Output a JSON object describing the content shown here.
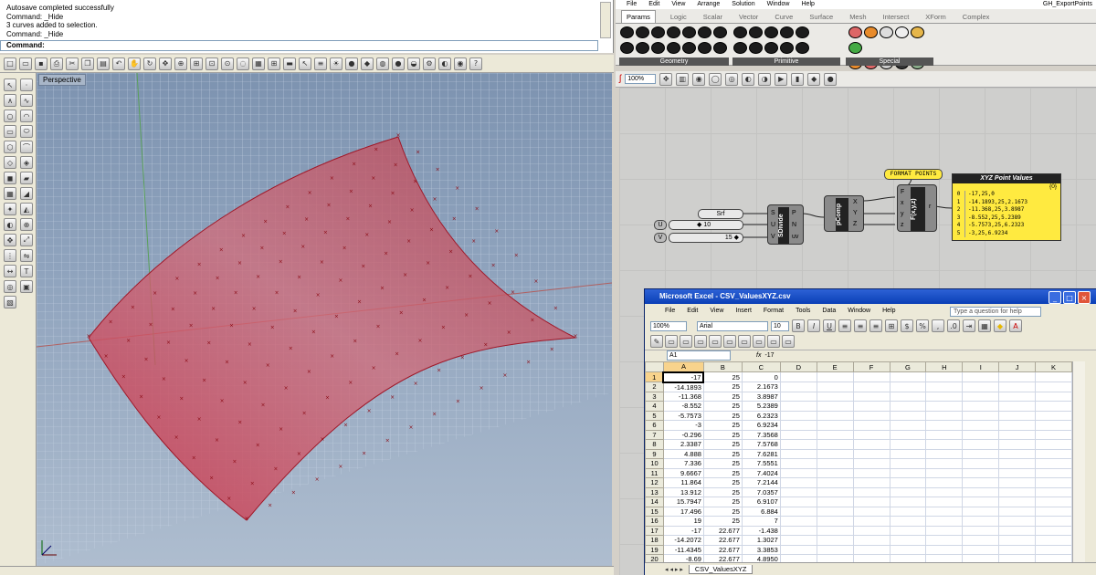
{
  "rhino": {
    "history": [
      "Autosave completed successfully",
      "Command: _Hide",
      "3 curves added to selection.",
      "Command: _Hide"
    ],
    "command_prompt": "Command:",
    "viewport_label": "Perspective"
  },
  "grasshopper": {
    "menu": [
      "File",
      "Edit",
      "View",
      "Arrange",
      "Solution",
      "Window",
      "Help"
    ],
    "doc_title": "GH_ExportPoints",
    "tabs": [
      "Params",
      "Logic",
      "Scalar",
      "Vector",
      "Curve",
      "Surface",
      "Mesh",
      "Intersect",
      "XForm",
      "Complex"
    ],
    "active_tab": "Params",
    "panels": [
      "Geometry",
      "Primitive",
      "Special"
    ],
    "zoom": "100%",
    "format_label": "FORMAT POINTS",
    "srf_label": "Srf",
    "u_slider": {
      "label": "U",
      "value": "◆ 10"
    },
    "v_slider": {
      "label": "V",
      "value": "15 ◆"
    },
    "sdivide": {
      "name": "SDivide",
      "inputs": [
        "S",
        "U",
        "V"
      ],
      "outputs": [
        "P",
        "N",
        "uv"
      ]
    },
    "pcomp": {
      "name": "pComp",
      "outputs": [
        "X",
        "Y",
        "Z"
      ]
    },
    "fxyz": {
      "name": "F(x,y,z)",
      "inputs": [
        "F",
        "x",
        "y",
        "z"
      ],
      "output": "r"
    },
    "panel_title": "XYZ Point Values",
    "panel_index": "{0}",
    "panel_rows": [
      "-17,25,0",
      "-14.1893,25,2.1673",
      "-11.368,25,3.8987",
      "-8.552,25,5.2389",
      "-5.7573,25,6.2323",
      "-3,25,6.9234"
    ]
  },
  "excel": {
    "title": "Microsoft Excel - CSV_ValuesXYZ.csv",
    "menu": [
      "File",
      "Edit",
      "View",
      "Insert",
      "Format",
      "Tools",
      "Data",
      "Window",
      "Help"
    ],
    "help_placeholder": "Type a question for help",
    "zoom": "100%",
    "font": "Arial",
    "font_size": "10",
    "name_box": "A1",
    "fx": "fx",
    "formula": "-17",
    "columns": [
      "A",
      "B",
      "C",
      "D",
      "E",
      "F",
      "G",
      "H",
      "I",
      "J",
      "K"
    ],
    "rows": [
      [
        "-17",
        "25",
        "0"
      ],
      [
        "-14.1893",
        "25",
        "2.1673"
      ],
      [
        "-11.368",
        "25",
        "3.8987"
      ],
      [
        "-8.552",
        "25",
        "5.2389"
      ],
      [
        "-5.7573",
        "25",
        "6.2323"
      ],
      [
        "-3",
        "25",
        "6.9234"
      ],
      [
        "-0.296",
        "25",
        "7.3568"
      ],
      [
        "2.3387",
        "25",
        "7.5768"
      ],
      [
        "4.888",
        "25",
        "7.6281"
      ],
      [
        "7.336",
        "25",
        "7.5551"
      ],
      [
        "9.6667",
        "25",
        "7.4024"
      ],
      [
        "11.864",
        "25",
        "7.2144"
      ],
      [
        "13.912",
        "25",
        "7.0357"
      ],
      [
        "15.7947",
        "25",
        "6.9107"
      ],
      [
        "17.496",
        "25",
        "6.884"
      ],
      [
        "19",
        "25",
        "7"
      ],
      [
        "-17",
        "22.677",
        "-1.438"
      ],
      [
        "-14.2072",
        "22.677",
        "1.3027"
      ],
      [
        "-11.4345",
        "22.677",
        "3.3853"
      ],
      [
        "-8.69",
        "22.677",
        "4.8950"
      ]
    ],
    "sheet_tab": "CSV_ValuesXYZ"
  }
}
